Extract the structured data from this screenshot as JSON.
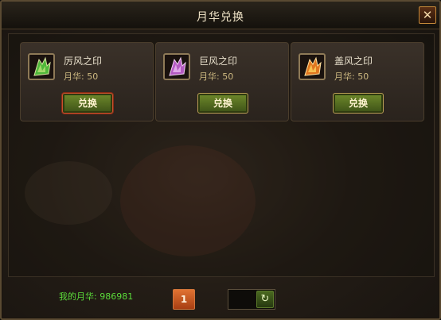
{
  "window": {
    "title": "月华兑换",
    "close_icon": "close-icon"
  },
  "items": [
    {
      "name": "厉风之印",
      "cost": "月华: 50",
      "button": "兑换",
      "icon": "green-wing-icon",
      "color": "#6cc94a"
    },
    {
      "name": "巨风之印",
      "cost": "月华: 50",
      "button": "兑换",
      "icon": "purple-wing-icon",
      "color": "#c47ad0"
    },
    {
      "name": "盖风之印",
      "cost": "月华: 50",
      "button": "兑换",
      "icon": "orange-wing-icon",
      "color": "#e8892a"
    }
  ],
  "footer": {
    "balance": "我的月华: 986981",
    "page": "1",
    "refresh_icon": "refresh-icon"
  }
}
